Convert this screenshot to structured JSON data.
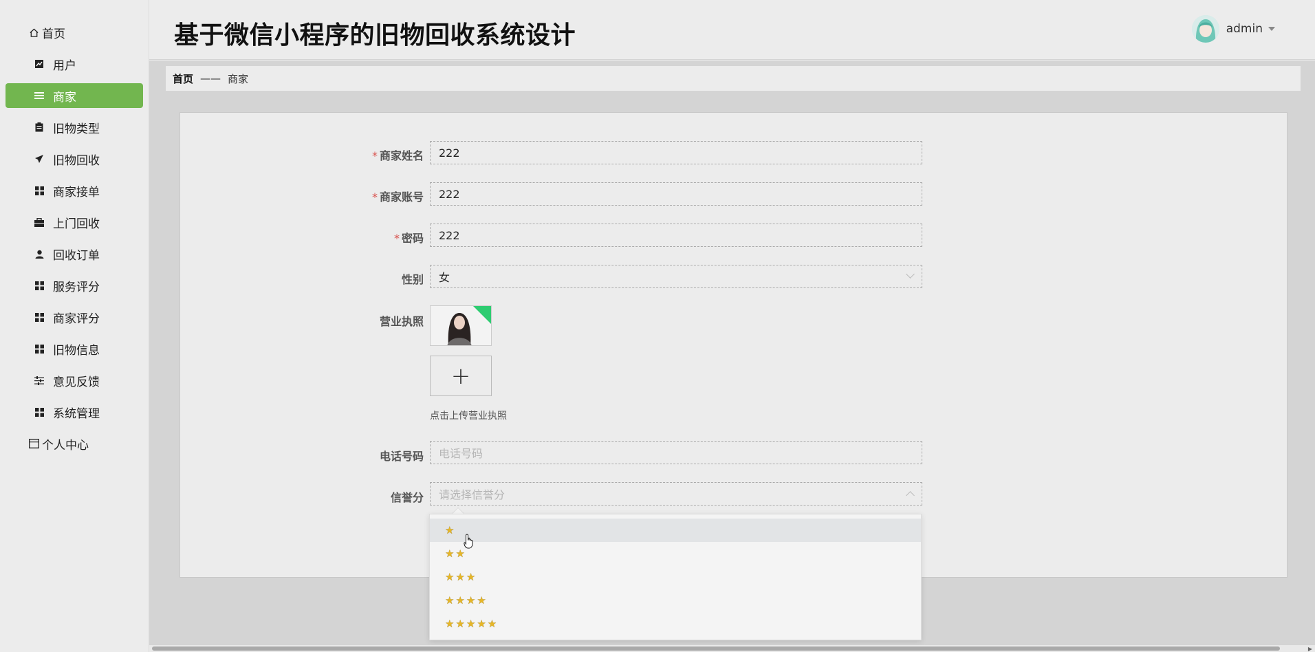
{
  "header": {
    "title": "基于微信小程序的旧物回收系统设计",
    "user": "admin"
  },
  "sidebar": {
    "items": [
      {
        "label": "首页",
        "icon": "home-icon",
        "type": "top"
      },
      {
        "label": "用户",
        "icon": "chart-icon",
        "type": "sub"
      },
      {
        "label": "商家",
        "icon": "list-icon",
        "type": "sub",
        "active": true
      },
      {
        "label": "旧物类型",
        "icon": "clipboard-icon",
        "type": "sub"
      },
      {
        "label": "旧物回收",
        "icon": "send-icon",
        "type": "sub"
      },
      {
        "label": "商家接单",
        "icon": "grid-icon",
        "type": "sub"
      },
      {
        "label": "上门回收",
        "icon": "briefcase-icon",
        "type": "sub"
      },
      {
        "label": "回收订单",
        "icon": "person-icon",
        "type": "sub"
      },
      {
        "label": "服务评分",
        "icon": "grid-icon",
        "type": "sub"
      },
      {
        "label": "商家评分",
        "icon": "grid-icon",
        "type": "sub"
      },
      {
        "label": "旧物信息",
        "icon": "grid-icon",
        "type": "sub"
      },
      {
        "label": "意见反馈",
        "icon": "sliders-icon",
        "type": "sub"
      },
      {
        "label": "系统管理",
        "icon": "grid-icon",
        "type": "sub"
      },
      {
        "label": "个人中心",
        "icon": "window-icon",
        "type": "top"
      }
    ]
  },
  "breadcrumb": {
    "home": "首页",
    "separator": "——",
    "current": "商家"
  },
  "form": {
    "name": {
      "label": "商家姓名",
      "value": "222"
    },
    "account": {
      "label": "商家账号",
      "value": "222"
    },
    "password": {
      "label": "密码",
      "value": "222"
    },
    "gender": {
      "label": "性别",
      "value": "女"
    },
    "license": {
      "label": "营业执照",
      "hint": "点击上传营业执照",
      "upload_glyph": "+"
    },
    "phone": {
      "label": "电话号码",
      "placeholder": "电话号码"
    },
    "credit": {
      "label": "信誉分",
      "placeholder": "请选择信誉分"
    },
    "required_mark": "*"
  },
  "credit_options": [
    "★",
    "★★",
    "★★★",
    "★★★★",
    "★★★★★"
  ],
  "colors": {
    "accent": "#72b64f",
    "star": "#e6b627",
    "required": "#d9534f"
  }
}
